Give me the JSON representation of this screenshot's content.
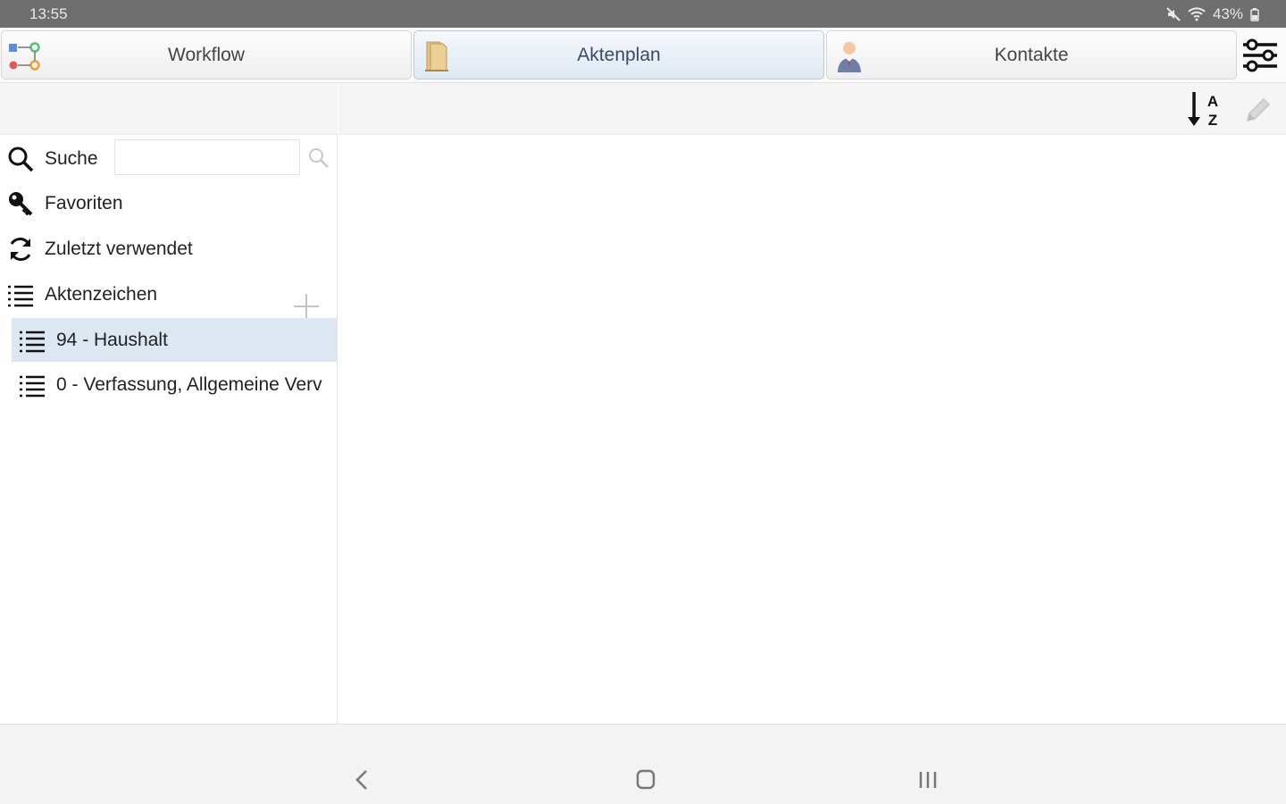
{
  "status_bar": {
    "time": "13:55",
    "battery": "43%",
    "icons": [
      "mute-icon",
      "wifi-icon",
      "battery-icon"
    ]
  },
  "tabs": [
    {
      "label": "Workflow",
      "icon": "workflow-icon",
      "active": false
    },
    {
      "label": "Aktenplan",
      "icon": "folder-icon",
      "active": true
    },
    {
      "label": "Kontakte",
      "icon": "contact-person-icon",
      "active": false
    }
  ],
  "left_nav": {
    "search": {
      "label": "Suche",
      "value": "",
      "placeholder": ""
    },
    "favorites": {
      "label": "Favoriten"
    },
    "recent": {
      "label": "Zuletzt verwendet"
    },
    "file_codes": {
      "label": "Aktenzeichen"
    },
    "tree": [
      {
        "label": "94 - Haushalt",
        "selected": true
      },
      {
        "label": "0 - Verfassung, Allgemeine Verv",
        "selected": false
      }
    ]
  },
  "toolbar": {
    "sort_icon": "sort-az-icon",
    "edit_icon": "pencil-icon"
  },
  "colors": {
    "status_bar": "#6e6e6e",
    "selection": "#dde7f2",
    "active_tab_text": "#3a4a66"
  }
}
